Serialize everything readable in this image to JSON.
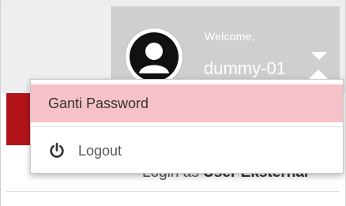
{
  "header": {
    "welcome_label": "Welcome,",
    "username": "dummy-01",
    "avatar_icon": "user-silhouette-icon",
    "dropdown_icon": "caret-down-icon"
  },
  "dropdown": {
    "items": [
      {
        "label": "Ganti Password",
        "highlighted": true
      },
      {
        "label": "Logout",
        "icon": "power-icon"
      }
    ]
  },
  "content": {
    "login_as_prefix": "Login as",
    "login_as_role": "User Eksternal"
  },
  "colors": {
    "header_bg": "#cfcfcf",
    "brand_red": "#b3141b",
    "menu_highlight": "#f6c1c8"
  }
}
